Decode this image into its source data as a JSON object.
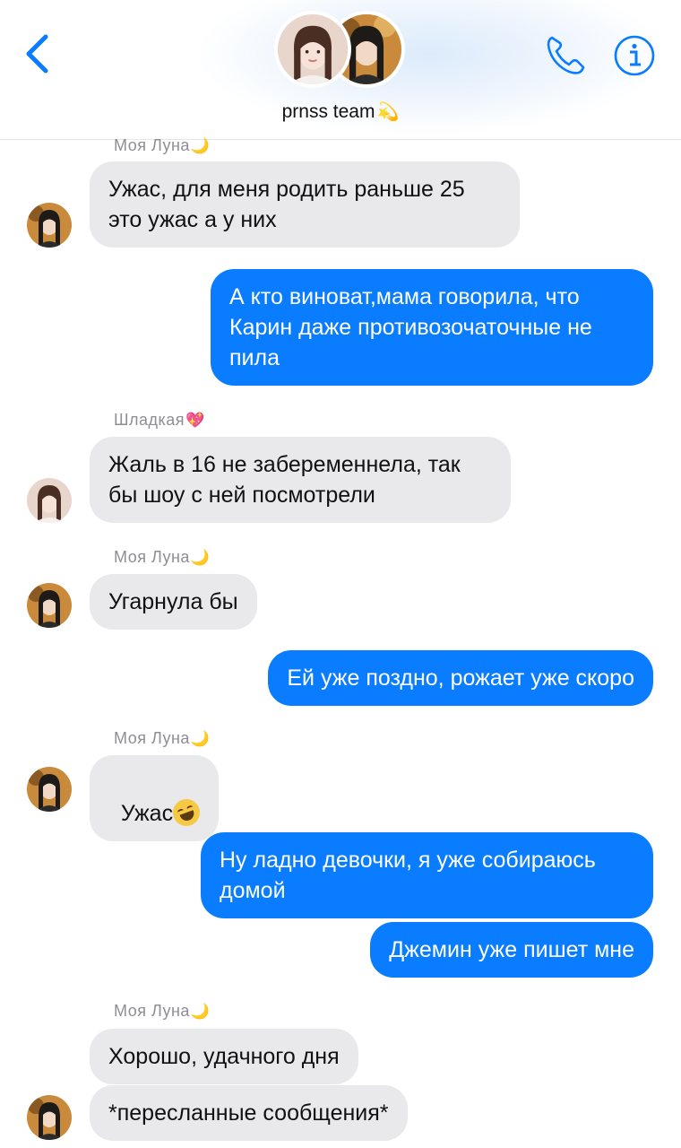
{
  "header": {
    "group_name": "prnss team",
    "group_emoji": "💫",
    "back_icon": "chevron-left-icon",
    "call_icon": "phone-icon",
    "info_icon": "info-icon",
    "accent_color": "#0a7cff"
  },
  "messages": [
    {
      "sender": "Моя Луна",
      "sender_emoji": "🌙",
      "text": "Ужас, для меня родить раньше 25\nэто ужас а у них"
    },
    {
      "text": "А кто виноват,мама говорила, что\nКарин даже противозочаточные не\nпила"
    },
    {
      "sender": "Шладкая",
      "sender_emoji": "💖",
      "text": "Жаль в 16 не забеременнела, так\nбы шоу с ней посмотрели"
    },
    {
      "sender": "Моя Луна",
      "sender_emoji": "🌙",
      "text": "Угарнула бы"
    },
    {
      "text": "Ей уже поздно, рожает уже скоро"
    },
    {
      "sender": "Моя Луна",
      "sender_emoji": "🌙",
      "text": "Ужас",
      "emoji": "rolling-on-floor-laughing"
    },
    {
      "text": "Ну ладно девочки, я уже собираюсь\nдомой"
    },
    {
      "text": "Джемин уже пишет мне"
    },
    {
      "sender": "Моя Луна",
      "sender_emoji": "🌙",
      "text": "Хорошо, удачного дня"
    },
    {
      "text": "*пересланные сообщения*"
    }
  ],
  "colors": {
    "incoming_bubble": "#e9e9eb",
    "outgoing_bubble": "#0a7cff",
    "sender_label": "#8e8e93"
  }
}
